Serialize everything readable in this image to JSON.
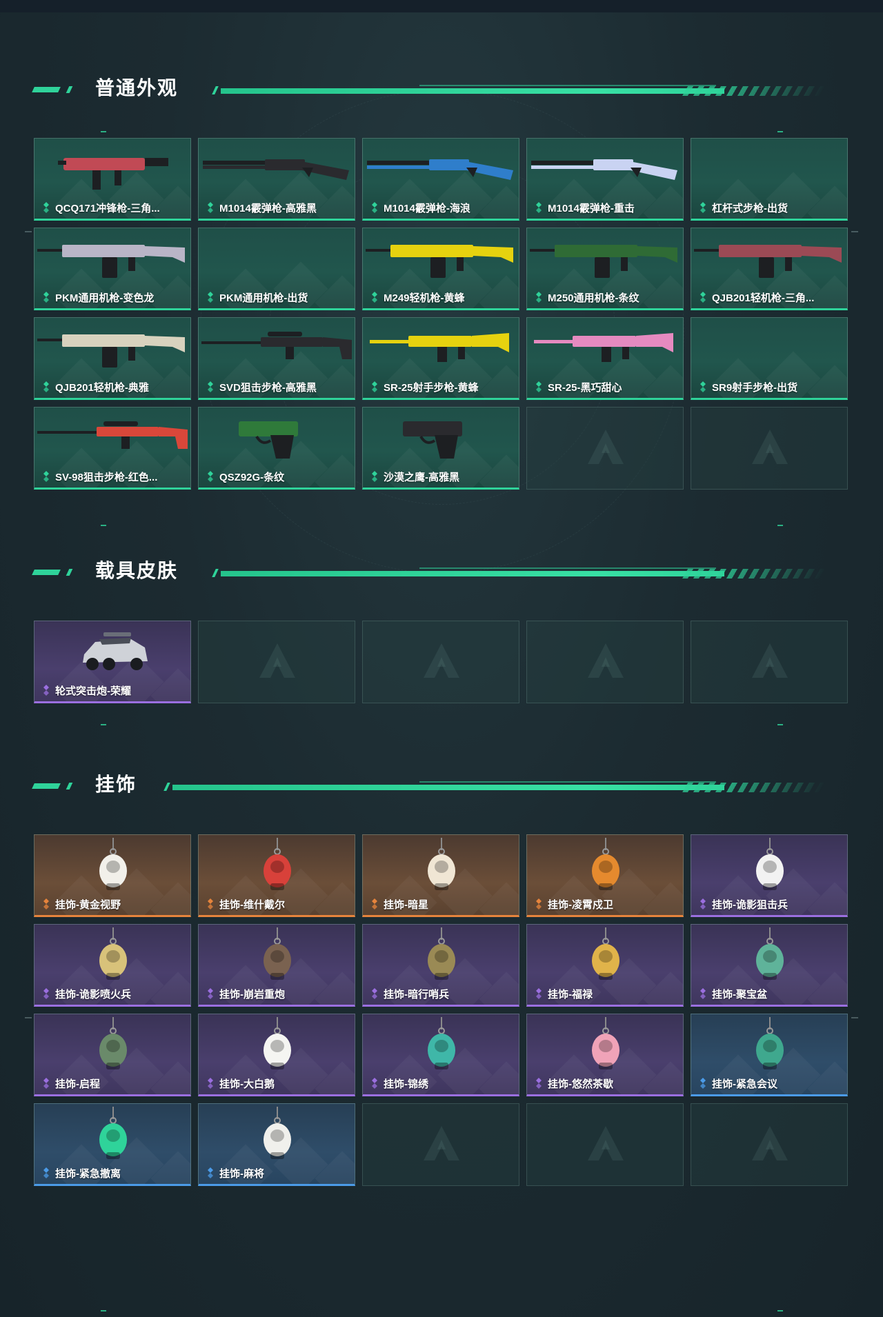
{
  "sections": [
    {
      "title": "普通外观",
      "items": [
        {
          "name": "QCQ171冲锋枪-三角...",
          "rarity": "green",
          "icon": "smg-icon",
          "accent": "#c14a55"
        },
        {
          "name": "M1014霰弹枪-高雅黑",
          "rarity": "green",
          "icon": "shotgun-icon",
          "accent": "#2a2a2e"
        },
        {
          "name": "M1014霰弹枪-海浪",
          "rarity": "green",
          "icon": "shotgun-icon",
          "accent": "#2f7ecb"
        },
        {
          "name": "M1014霰弹枪-重击",
          "rarity": "green",
          "icon": "shotgun-icon",
          "accent": "#c9d3f2"
        },
        {
          "name": "杠杆式步枪-出货",
          "rarity": "green",
          "icon": "none",
          "accent": ""
        },
        {
          "name": "PKM通用机枪-变色龙",
          "rarity": "green",
          "icon": "machine-gun-icon",
          "accent": "#b9b5c7"
        },
        {
          "name": "PKM通用机枪-出货",
          "rarity": "green",
          "icon": "none",
          "accent": ""
        },
        {
          "name": "M249轻机枪-黄蜂",
          "rarity": "green",
          "icon": "machine-gun-icon",
          "accent": "#e6d20f"
        },
        {
          "name": "M250通用机枪-条纹",
          "rarity": "green",
          "icon": "machine-gun-icon",
          "accent": "#2f6b35"
        },
        {
          "name": "QJB201轻机枪-三角...",
          "rarity": "green",
          "icon": "machine-gun-icon",
          "accent": "#9b4a55"
        },
        {
          "name": "QJB201轻机枪-典雅",
          "rarity": "green",
          "icon": "machine-gun-icon",
          "accent": "#d8d2be"
        },
        {
          "name": "SVD狙击步枪-高雅黑",
          "rarity": "green",
          "icon": "sniper-rifle-icon",
          "accent": "#2a2a2e"
        },
        {
          "name": "SR-25射手步枪-黄蜂",
          "rarity": "green",
          "icon": "rifle-icon",
          "accent": "#e6d20f"
        },
        {
          "name": "SR-25-黑巧甜心",
          "rarity": "green",
          "icon": "rifle-icon",
          "accent": "#e58ac0"
        },
        {
          "name": "SR9射手步枪-出货",
          "rarity": "green",
          "icon": "none",
          "accent": ""
        },
        {
          "name": "SV-98狙击步枪-红色...",
          "rarity": "green",
          "icon": "sniper-rifle-icon",
          "accent": "#d9473a"
        },
        {
          "name": "QSZ92G-条纹",
          "rarity": "green",
          "icon": "pistol-icon",
          "accent": "#2f7a3a"
        },
        {
          "name": "沙漠之鹰-高雅黑",
          "rarity": "green",
          "icon": "pistol-icon",
          "accent": "#2a2a2e"
        }
      ],
      "empty_slots": 2
    },
    {
      "title": "载具皮肤",
      "items": [
        {
          "name": "轮式突击炮-荣耀",
          "rarity": "purple",
          "icon": "vehicle-icon",
          "accent": "#cfd2d8"
        }
      ],
      "empty_slots": 4
    },
    {
      "title": "挂饰",
      "items": [
        {
          "name": "挂饰-黄金视野",
          "rarity": "orange",
          "icon": "charm-icon",
          "accent": "#f2f0ea"
        },
        {
          "name": "挂饰-维什戴尔",
          "rarity": "orange",
          "icon": "charm-icon",
          "accent": "#d8413a"
        },
        {
          "name": "挂饰-暗星",
          "rarity": "orange",
          "icon": "charm-icon",
          "accent": "#f0e6d4"
        },
        {
          "name": "挂饰-凌霄戍卫",
          "rarity": "orange",
          "icon": "charm-icon",
          "accent": "#e58a2e"
        },
        {
          "name": "挂饰-诡影狙击兵",
          "rarity": "purple",
          "icon": "charm-icon",
          "accent": "#f2f2f2"
        },
        {
          "name": "挂饰-诡影喷火兵",
          "rarity": "purple",
          "icon": "charm-icon",
          "accent": "#d8c27a"
        },
        {
          "name": "挂饰-崩岩重炮",
          "rarity": "purple",
          "icon": "charm-icon",
          "accent": "#7a6250"
        },
        {
          "name": "挂饰-暗行哨兵",
          "rarity": "purple",
          "icon": "charm-icon",
          "accent": "#9a8a55"
        },
        {
          "name": "挂饰-福禄",
          "rarity": "purple",
          "icon": "charm-icon",
          "accent": "#e0b34a"
        },
        {
          "name": "挂饰-聚宝盆",
          "rarity": "purple",
          "icon": "charm-icon",
          "accent": "#5fb39a"
        },
        {
          "name": "挂饰-启程",
          "rarity": "purple",
          "icon": "charm-icon",
          "accent": "#6a8a6a"
        },
        {
          "name": "挂饰-大白鹅",
          "rarity": "purple",
          "icon": "charm-icon",
          "accent": "#f5f5f2"
        },
        {
          "name": "挂饰-锦绣",
          "rarity": "purple",
          "icon": "charm-icon",
          "accent": "#3fb7a8"
        },
        {
          "name": "挂饰-悠然茶歇",
          "rarity": "purple",
          "icon": "charm-icon",
          "accent": "#f0a3b8"
        },
        {
          "name": "挂饰-紧急会议",
          "rarity": "blue",
          "icon": "charm-icon",
          "accent": "#3fa88e"
        },
        {
          "name": "挂饰-紧急撤离",
          "rarity": "blue",
          "icon": "charm-icon",
          "accent": "#2fd39a"
        },
        {
          "name": "挂饰-麻将",
          "rarity": "blue",
          "icon": "charm-icon",
          "accent": "#f0f0ec"
        }
      ],
      "empty_slots": 3
    }
  ],
  "colors": {
    "accent": "#2fd39a",
    "green": "#2fd39a",
    "purple": "#9b6fe0",
    "orange": "#e7843c",
    "blue": "#4b9be8"
  }
}
